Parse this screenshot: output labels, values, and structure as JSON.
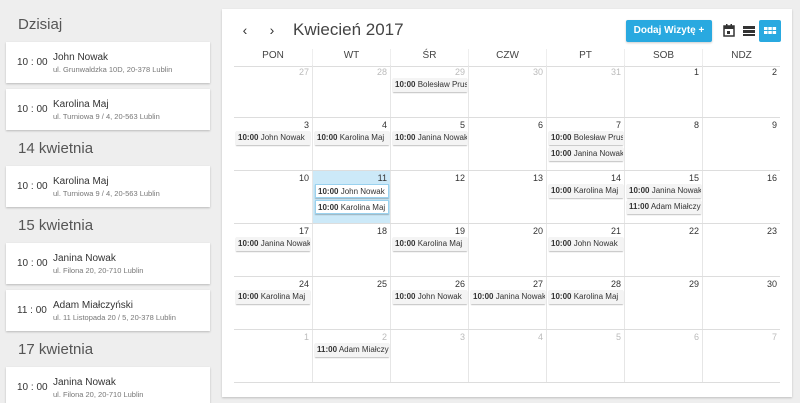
{
  "sidebar": {
    "groups": [
      {
        "heading": "Dzisiaj",
        "items": [
          {
            "time": "10 : 00",
            "name": "John Nowak",
            "address": "ul. Grunwaldzka 10D, 20-378 Lublin"
          },
          {
            "time": "10 : 00",
            "name": "Karolina Maj",
            "address": "ul. Turniowa 9 / 4, 20-563 Lublin"
          }
        ]
      },
      {
        "heading": "14 kwietnia",
        "items": [
          {
            "time": "10 : 00",
            "name": "Karolina Maj",
            "address": "ul. Turniowa 9 / 4, 20-563 Lublin"
          }
        ]
      },
      {
        "heading": "15 kwietnia",
        "items": [
          {
            "time": "10 : 00",
            "name": "Janina Nowak",
            "address": "ul. Filona 20, 20-710 Lublin"
          },
          {
            "time": "11 : 00",
            "name": "Adam Miałczyński",
            "address": "ul. 11 Listopada 20 / 5, 20-378 Lublin"
          }
        ]
      },
      {
        "heading": "17 kwietnia",
        "items": [
          {
            "time": "10 : 00",
            "name": "Janina Nowak",
            "address": "ul. Filona 20, 20-710 Lublin"
          }
        ]
      }
    ]
  },
  "calendar": {
    "prev_label": "‹",
    "next_label": "›",
    "title": "Kwiecień 2017",
    "add_button": "Dodaj Wizytę +",
    "accent": "#29a9e0",
    "views": [
      "calendar-day-icon",
      "calendar-week-icon",
      "calendar-month-icon"
    ],
    "active_view": "month",
    "weekdays": [
      "PON",
      "WT",
      "ŚR",
      "CZW",
      "PT",
      "SOB",
      "NDZ"
    ],
    "weeks": [
      [
        {
          "n": "27",
          "other": true,
          "events": []
        },
        {
          "n": "28",
          "other": true,
          "events": []
        },
        {
          "n": "29",
          "other": true,
          "events": [
            {
              "t": "10:00",
              "name": "Bolesław Prus"
            }
          ]
        },
        {
          "n": "30",
          "other": true,
          "events": []
        },
        {
          "n": "31",
          "other": true,
          "events": []
        },
        {
          "n": "1",
          "events": []
        },
        {
          "n": "2",
          "events": []
        }
      ],
      [
        {
          "n": "3",
          "events": [
            {
              "t": "10:00",
              "name": "John Nowak"
            }
          ]
        },
        {
          "n": "4",
          "events": [
            {
              "t": "10:00",
              "name": "Karolina Maj"
            }
          ]
        },
        {
          "n": "5",
          "events": [
            {
              "t": "10:00",
              "name": "Janina Nowak"
            }
          ]
        },
        {
          "n": "6",
          "events": []
        },
        {
          "n": "7",
          "events": [
            {
              "t": "10:00",
              "name": "Bolesław Prus"
            },
            {
              "t": "10:00",
              "name": "Janina Nowak"
            }
          ]
        },
        {
          "n": "8",
          "events": []
        },
        {
          "n": "9",
          "events": []
        }
      ],
      [
        {
          "n": "10",
          "events": []
        },
        {
          "n": "11",
          "today": true,
          "events": [
            {
              "t": "10:00",
              "name": "John Nowak",
              "hl": true
            },
            {
              "t": "10:00",
              "name": "Karolina Maj",
              "hl": true
            }
          ]
        },
        {
          "n": "12",
          "events": []
        },
        {
          "n": "13",
          "events": []
        },
        {
          "n": "14",
          "events": [
            {
              "t": "10:00",
              "name": "Karolina Maj"
            }
          ]
        },
        {
          "n": "15",
          "events": [
            {
              "t": "10:00",
              "name": "Janina Nowak"
            },
            {
              "t": "11:00",
              "name": "Adam Miałczyński"
            }
          ]
        },
        {
          "n": "16",
          "events": []
        }
      ],
      [
        {
          "n": "17",
          "events": [
            {
              "t": "10:00",
              "name": "Janina Nowak"
            }
          ]
        },
        {
          "n": "18",
          "events": []
        },
        {
          "n": "19",
          "events": [
            {
              "t": "10:00",
              "name": "Karolina Maj"
            }
          ]
        },
        {
          "n": "20",
          "events": []
        },
        {
          "n": "21",
          "events": [
            {
              "t": "10:00",
              "name": "John Nowak"
            }
          ]
        },
        {
          "n": "22",
          "events": []
        },
        {
          "n": "23",
          "events": []
        }
      ],
      [
        {
          "n": "24",
          "events": [
            {
              "t": "10:00",
              "name": "Karolina Maj"
            }
          ]
        },
        {
          "n": "25",
          "events": []
        },
        {
          "n": "26",
          "events": [
            {
              "t": "10:00",
              "name": "John Nowak"
            }
          ]
        },
        {
          "n": "27",
          "events": [
            {
              "t": "10:00",
              "name": "Janina Nowak"
            }
          ]
        },
        {
          "n": "28",
          "events": [
            {
              "t": "10:00",
              "name": "Karolina Maj"
            }
          ]
        },
        {
          "n": "29",
          "events": []
        },
        {
          "n": "30",
          "events": []
        }
      ],
      [
        {
          "n": "1",
          "other": true,
          "events": []
        },
        {
          "n": "2",
          "other": true,
          "events": [
            {
              "t": "11:00",
              "name": "Adam Miałczyński"
            }
          ]
        },
        {
          "n": "3",
          "other": true,
          "events": []
        },
        {
          "n": "4",
          "other": true,
          "events": []
        },
        {
          "n": "5",
          "other": true,
          "events": []
        },
        {
          "n": "6",
          "other": true,
          "events": []
        },
        {
          "n": "7",
          "other": true,
          "events": []
        }
      ]
    ]
  }
}
